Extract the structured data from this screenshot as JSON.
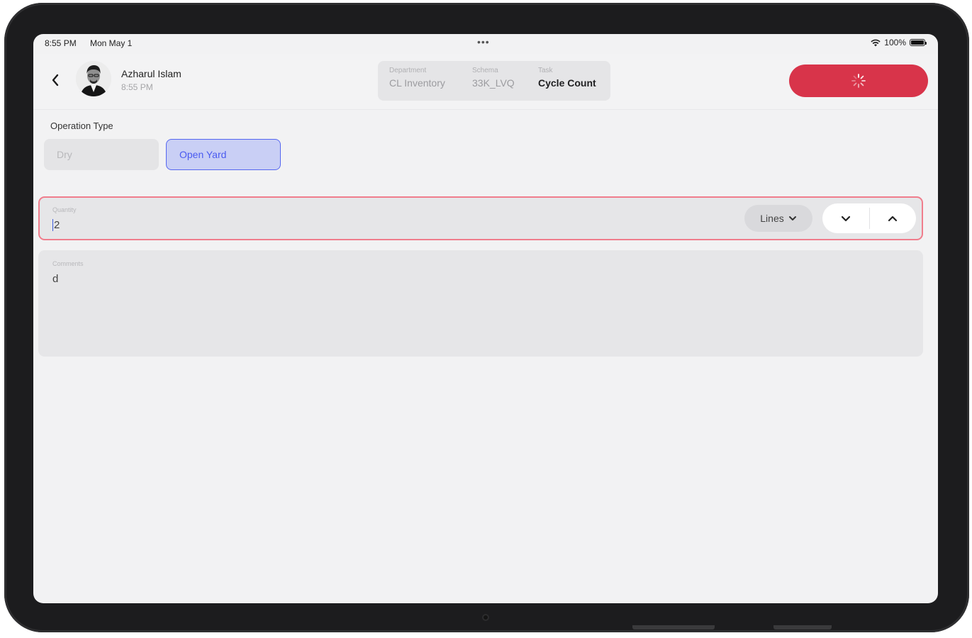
{
  "status_bar": {
    "time": "8:55 PM",
    "date": "Mon May 1",
    "dots": "•••",
    "battery_text": "100%",
    "icons": [
      "wifi-icon",
      "battery-icon"
    ]
  },
  "header": {
    "user": {
      "name": "Azharul Islam",
      "time": "8:55 PM"
    },
    "info": {
      "department_label": "Department",
      "department_value": "CL Inventory",
      "schema_label": "Schema",
      "schema_value": "33K_LVQ",
      "task_label": "Task",
      "task_value": "Cycle Count"
    },
    "action_button": {
      "icon": "loading-spinner-icon",
      "color": "#d8344a"
    }
  },
  "operation_type": {
    "label": "Operation Type",
    "options": [
      "Dry",
      "Open Yard"
    ],
    "selected": "Open Yard"
  },
  "quantity": {
    "label": "Quantity",
    "value": "2",
    "unit": "Lines",
    "stepper_icons": [
      "chevron-down-icon",
      "chevron-up-icon"
    ],
    "error_border_color": "#f07d8c"
  },
  "comments": {
    "label": "Comments",
    "value": "d"
  },
  "colors": {
    "accent": "#4a5bf0",
    "danger": "#d8344a"
  }
}
